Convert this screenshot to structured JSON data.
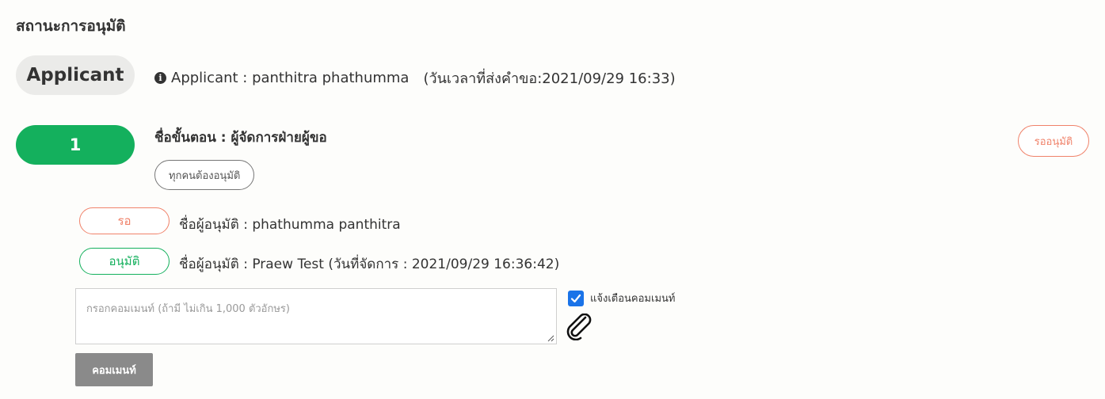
{
  "section_title": "สถานะการอนุมัติ",
  "applicant": {
    "pill_label": "Applicant",
    "info_icon": "info-circle-icon",
    "info_text": "Applicant : panthitra phathumma",
    "timestamp_text": "(วันเวลาที่ส่งคำขอ:2021/09/29 16:33)"
  },
  "step": {
    "number": "1",
    "name": "ชื่อขั้นตอน : ผู้จัดการฝ่ายผู้ขอ",
    "rule_tag": "ทุกคนต้องอนุมัติ",
    "status_tag": "รออนุมัติ"
  },
  "approvers": [
    {
      "status": "รอ",
      "text": "ชื่อผู้อนุมัติ : phathumma panthitra"
    },
    {
      "status": "อนุมัติ",
      "text": "ชื่อผู้อนุมัติ : Praew Test (วันที่จัดการ : 2021/09/29 16:36:42)"
    }
  ],
  "comment": {
    "placeholder": "กรอกคอมเมนท์ (ถ้ามี ไม่เกิน 1,000 ตัวอักษร)",
    "notify_label": "แจ้งเตือนคอมเมนท์",
    "notify_checked": true,
    "attach_icon": "paperclip-icon",
    "button_label": "คอมเมนท์"
  },
  "colors": {
    "green": "#14b05d",
    "orange": "#f0826a",
    "gray_button": "#8a8a8a",
    "checkbox_blue": "#1a73e8"
  }
}
